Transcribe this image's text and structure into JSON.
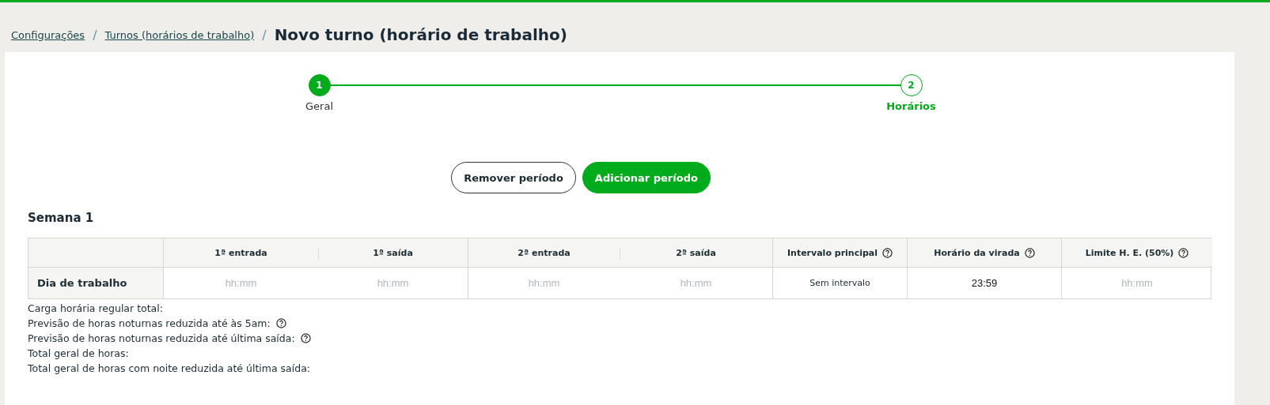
{
  "breadcrumb": {
    "links": [
      "Configurações",
      "Turnos (horários de trabalho)"
    ],
    "separators": [
      "/",
      "/"
    ],
    "title": "Novo turno (horário de trabalho)"
  },
  "steps": [
    {
      "number": "1",
      "label": "Geral",
      "done": true,
      "selected": false
    },
    {
      "number": "2",
      "label": "Horários",
      "done": false,
      "selected": true
    }
  ],
  "buttons": [
    {
      "label": "Remover período",
      "kind": "outline"
    },
    {
      "label": "Adicionar período",
      "kind": "primary"
    }
  ],
  "week": {
    "title": "Semana 1",
    "columns": [
      {
        "label": "1ª entrada",
        "help": false
      },
      {
        "label": "1ª saída",
        "help": false
      },
      {
        "label": "2ª entrada",
        "help": false
      },
      {
        "label": "2ª saída",
        "help": false
      },
      {
        "label": "Intervalo principal",
        "help": true
      },
      {
        "label": "Horário da virada",
        "help": true
      },
      {
        "label": "Limite H. E. (50%)",
        "help": true
      }
    ],
    "row_label": "Dia de trabalho",
    "cells": [
      {
        "kind": "input",
        "placeholder": "hh:mm"
      },
      {
        "kind": "input",
        "placeholder": "hh:mm"
      },
      {
        "kind": "input",
        "placeholder": "hh:mm"
      },
      {
        "kind": "input",
        "placeholder": "hh:mm"
      },
      {
        "kind": "text",
        "value": "Sem intervalo"
      },
      {
        "kind": "input",
        "value": "23:59"
      },
      {
        "kind": "input",
        "placeholder": "hh:mm"
      }
    ]
  },
  "summary": [
    {
      "label": "Carga horária regular total:",
      "help": false
    },
    {
      "label": "Previsão de horas noturnas reduzida até às 5am:",
      "help": true
    },
    {
      "label": "Previsão de horas noturnas reduzida até última saída:",
      "help": true
    },
    {
      "label": "Total geral de horas:",
      "help": false
    },
    {
      "label": "Total geral de horas com noite reduzida até última saída:",
      "help": false
    }
  ]
}
